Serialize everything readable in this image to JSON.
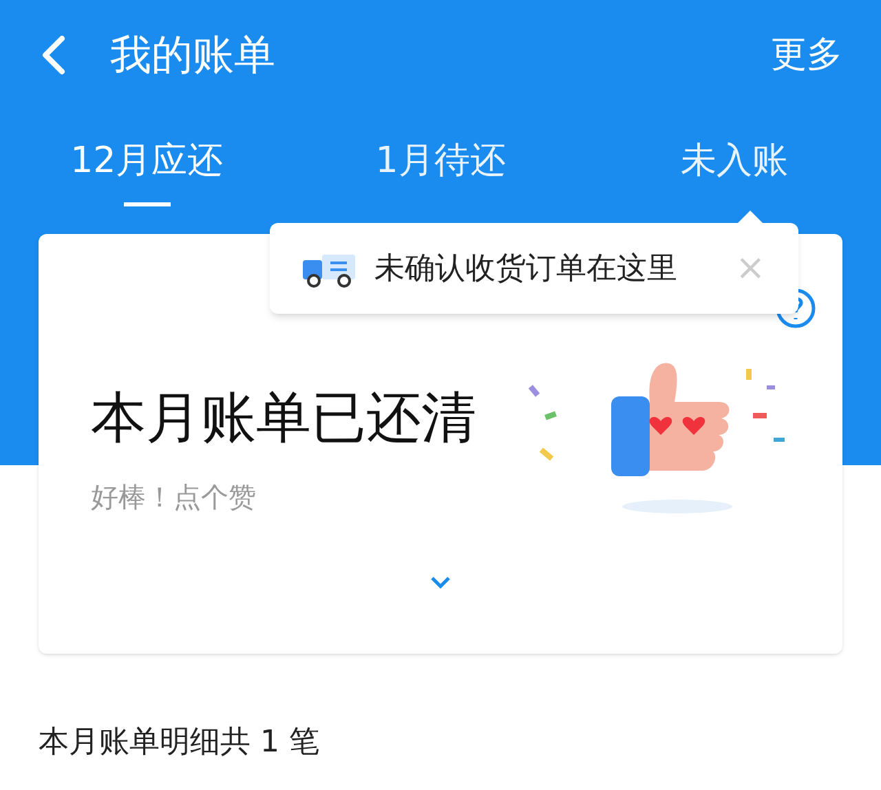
{
  "header": {
    "title": "我的账单",
    "more": "更多"
  },
  "tabs": [
    {
      "label": "12月应还",
      "selected": true
    },
    {
      "label": "1月待还",
      "selected": false
    },
    {
      "label": "未入账",
      "selected": false
    }
  ],
  "tooltip": {
    "text": "未确认收货订单在这里",
    "close": "×"
  },
  "summary": {
    "title": "本月账单已还清",
    "subtitle": "好棒！点个赞"
  },
  "details": {
    "text": "本月账单明细共 1 笔"
  }
}
